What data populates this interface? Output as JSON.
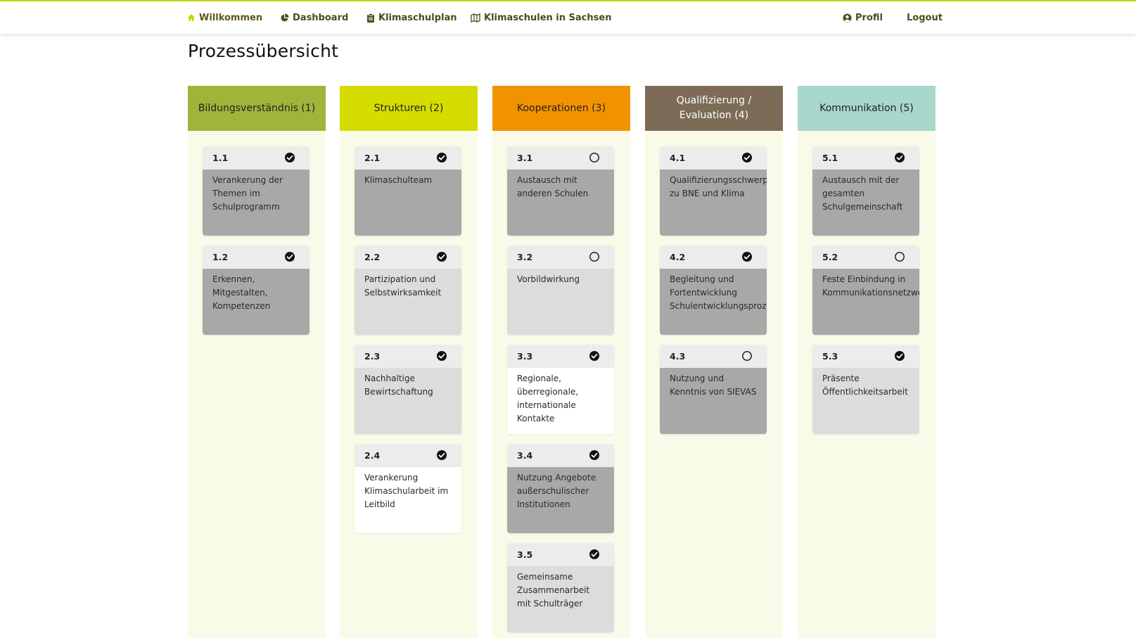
{
  "nav": {
    "home": "Willkommen",
    "dashboard": "Dashboard",
    "plan": "Klimaschulplan",
    "map": "Klimaschulen in Sachsen",
    "profile": "Profil",
    "logout": "Logout"
  },
  "page": {
    "title": "Prozessübersicht"
  },
  "colors": {
    "accent": "#c8d400",
    "col1": "#a0b43a",
    "col2": "#d4dc00",
    "col3": "#f39200",
    "col4": "#7c6c57",
    "col5": "#a8d7cc"
  },
  "columns": [
    {
      "title": "Bildungsverständnis (1)",
      "cards": [
        {
          "id": "1.1",
          "text": "Verankerung der Themen im Schulprogramm",
          "status": "check-circle-icon",
          "shade": "dark"
        },
        {
          "id": "1.2",
          "text": "Erkennen, Mitgestalten, Kompetenzen",
          "status": "check-circle-icon",
          "shade": "dark"
        }
      ]
    },
    {
      "title": "Strukturen (2)",
      "cards": [
        {
          "id": "2.1",
          "text": "Klimaschulteam",
          "status": "check-circle-icon",
          "shade": "dark"
        },
        {
          "id": "2.2",
          "text": "Partizipation und Selbstwirksamkeit",
          "status": "check-circle-icon",
          "shade": "light"
        },
        {
          "id": "2.3",
          "text": "Nachhaltige Bewirtschaftung",
          "status": "check-circle-icon",
          "shade": "light"
        },
        {
          "id": "2.4",
          "text": "Verankerung Klimaschularbeit im Leitbild",
          "status": "check-circle-icon",
          "shade": "white"
        }
      ]
    },
    {
      "title": "Kooperationen (3)",
      "cards": [
        {
          "id": "3.1",
          "text": "Austausch mit anderen Schulen",
          "status": "empty-circle-icon",
          "shade": "dark"
        },
        {
          "id": "3.2",
          "text": "Vorbildwirkung",
          "status": "empty-circle-icon",
          "shade": "light"
        },
        {
          "id": "3.3",
          "text": "Regionale, überregionale, internationale Kontakte",
          "status": "check-circle-icon",
          "shade": "white"
        },
        {
          "id": "3.4",
          "text": "Nutzung Angebote außerschulischer Institutionen",
          "status": "check-circle-icon",
          "shade": "dark"
        },
        {
          "id": "3.5",
          "text": "Gemeinsame Zusammenarbeit mit Schulträger",
          "status": "check-circle-icon",
          "shade": "light"
        }
      ]
    },
    {
      "title": "Qualifizierung / Evaluation (4)",
      "cards": [
        {
          "id": "4.1",
          "text": "Qualifizierungsschwerpunkt zu BNE und Klima",
          "status": "check-circle-icon",
          "shade": "dark"
        },
        {
          "id": "4.2",
          "text": "Begleitung und Fortentwicklung Schulentwicklungsprozess",
          "status": "check-circle-icon",
          "shade": "dark"
        },
        {
          "id": "4.3",
          "text": "Nutzung und Kenntnis von SIEVAS",
          "status": "empty-circle-icon",
          "shade": "dark"
        }
      ]
    },
    {
      "title": "Kommunikation (5)",
      "cards": [
        {
          "id": "5.1",
          "text": "Austausch mit der gesamten Schulgemeinschaft",
          "status": "check-circle-icon",
          "shade": "dark"
        },
        {
          "id": "5.2",
          "text": "Feste Einbindung in Kommunikationsnetzwerk",
          "status": "empty-circle-icon",
          "shade": "dark"
        },
        {
          "id": "5.3",
          "text": "Präsente Öffentlichkeitsarbeit",
          "status": "check-circle-icon",
          "shade": "light"
        }
      ]
    }
  ]
}
